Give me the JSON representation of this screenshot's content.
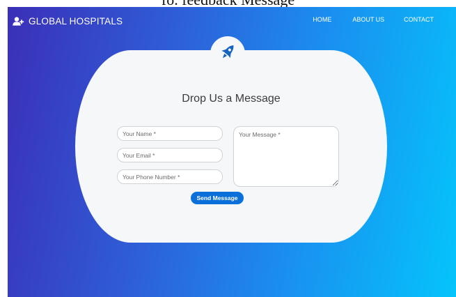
{
  "caption_fragment": "fo. feedback Message",
  "brand": {
    "name": "GLOBAL HOSPITALS",
    "icon": "user-plus-icon"
  },
  "nav": {
    "home": "HOME",
    "about": "ABOUT US",
    "contact": "CONTACT"
  },
  "badge": {
    "icon": "rocket-icon"
  },
  "form": {
    "title": "Drop Us a Message",
    "name_placeholder": "Your Name *",
    "email_placeholder": "Your Email *",
    "phone_placeholder": "Your Phone Number *",
    "message_placeholder": "Your Message *",
    "submit_label": "Send Message"
  },
  "colors": {
    "gradient_start": "#3b2fb8",
    "gradient_end": "#05c4fb",
    "button": "#0a6fd8",
    "card": "#f6f7f9"
  }
}
